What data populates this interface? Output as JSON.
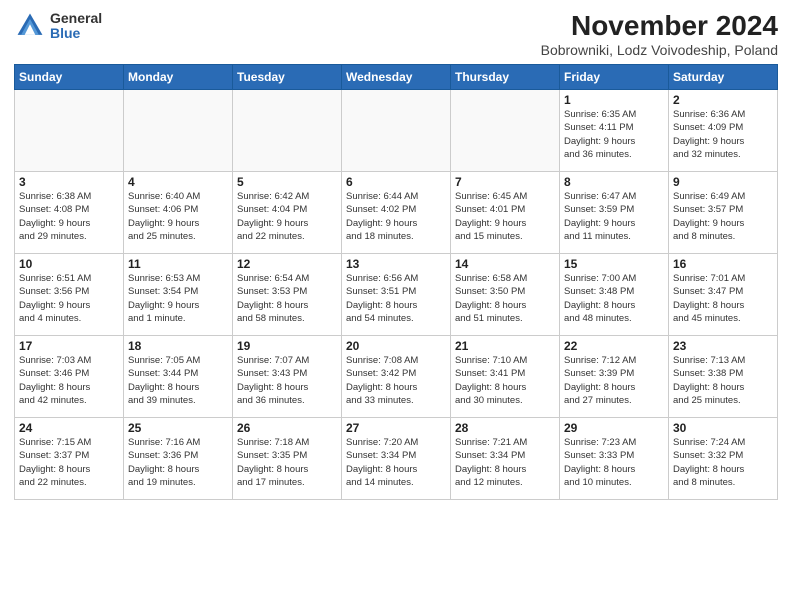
{
  "logo": {
    "general": "General",
    "blue": "Blue"
  },
  "header": {
    "title": "November 2024",
    "subtitle": "Bobrowniki, Lodz Voivodeship, Poland"
  },
  "weekdays": [
    "Sunday",
    "Monday",
    "Tuesday",
    "Wednesday",
    "Thursday",
    "Friday",
    "Saturday"
  ],
  "weeks": [
    [
      {
        "day": "",
        "info": ""
      },
      {
        "day": "",
        "info": ""
      },
      {
        "day": "",
        "info": ""
      },
      {
        "day": "",
        "info": ""
      },
      {
        "day": "",
        "info": ""
      },
      {
        "day": "1",
        "info": "Sunrise: 6:35 AM\nSunset: 4:11 PM\nDaylight: 9 hours\nand 36 minutes."
      },
      {
        "day": "2",
        "info": "Sunrise: 6:36 AM\nSunset: 4:09 PM\nDaylight: 9 hours\nand 32 minutes."
      }
    ],
    [
      {
        "day": "3",
        "info": "Sunrise: 6:38 AM\nSunset: 4:08 PM\nDaylight: 9 hours\nand 29 minutes."
      },
      {
        "day": "4",
        "info": "Sunrise: 6:40 AM\nSunset: 4:06 PM\nDaylight: 9 hours\nand 25 minutes."
      },
      {
        "day": "5",
        "info": "Sunrise: 6:42 AM\nSunset: 4:04 PM\nDaylight: 9 hours\nand 22 minutes."
      },
      {
        "day": "6",
        "info": "Sunrise: 6:44 AM\nSunset: 4:02 PM\nDaylight: 9 hours\nand 18 minutes."
      },
      {
        "day": "7",
        "info": "Sunrise: 6:45 AM\nSunset: 4:01 PM\nDaylight: 9 hours\nand 15 minutes."
      },
      {
        "day": "8",
        "info": "Sunrise: 6:47 AM\nSunset: 3:59 PM\nDaylight: 9 hours\nand 11 minutes."
      },
      {
        "day": "9",
        "info": "Sunrise: 6:49 AM\nSunset: 3:57 PM\nDaylight: 9 hours\nand 8 minutes."
      }
    ],
    [
      {
        "day": "10",
        "info": "Sunrise: 6:51 AM\nSunset: 3:56 PM\nDaylight: 9 hours\nand 4 minutes."
      },
      {
        "day": "11",
        "info": "Sunrise: 6:53 AM\nSunset: 3:54 PM\nDaylight: 9 hours\nand 1 minute."
      },
      {
        "day": "12",
        "info": "Sunrise: 6:54 AM\nSunset: 3:53 PM\nDaylight: 8 hours\nand 58 minutes."
      },
      {
        "day": "13",
        "info": "Sunrise: 6:56 AM\nSunset: 3:51 PM\nDaylight: 8 hours\nand 54 minutes."
      },
      {
        "day": "14",
        "info": "Sunrise: 6:58 AM\nSunset: 3:50 PM\nDaylight: 8 hours\nand 51 minutes."
      },
      {
        "day": "15",
        "info": "Sunrise: 7:00 AM\nSunset: 3:48 PM\nDaylight: 8 hours\nand 48 minutes."
      },
      {
        "day": "16",
        "info": "Sunrise: 7:01 AM\nSunset: 3:47 PM\nDaylight: 8 hours\nand 45 minutes."
      }
    ],
    [
      {
        "day": "17",
        "info": "Sunrise: 7:03 AM\nSunset: 3:46 PM\nDaylight: 8 hours\nand 42 minutes."
      },
      {
        "day": "18",
        "info": "Sunrise: 7:05 AM\nSunset: 3:44 PM\nDaylight: 8 hours\nand 39 minutes."
      },
      {
        "day": "19",
        "info": "Sunrise: 7:07 AM\nSunset: 3:43 PM\nDaylight: 8 hours\nand 36 minutes."
      },
      {
        "day": "20",
        "info": "Sunrise: 7:08 AM\nSunset: 3:42 PM\nDaylight: 8 hours\nand 33 minutes."
      },
      {
        "day": "21",
        "info": "Sunrise: 7:10 AM\nSunset: 3:41 PM\nDaylight: 8 hours\nand 30 minutes."
      },
      {
        "day": "22",
        "info": "Sunrise: 7:12 AM\nSunset: 3:39 PM\nDaylight: 8 hours\nand 27 minutes."
      },
      {
        "day": "23",
        "info": "Sunrise: 7:13 AM\nSunset: 3:38 PM\nDaylight: 8 hours\nand 25 minutes."
      }
    ],
    [
      {
        "day": "24",
        "info": "Sunrise: 7:15 AM\nSunset: 3:37 PM\nDaylight: 8 hours\nand 22 minutes."
      },
      {
        "day": "25",
        "info": "Sunrise: 7:16 AM\nSunset: 3:36 PM\nDaylight: 8 hours\nand 19 minutes."
      },
      {
        "day": "26",
        "info": "Sunrise: 7:18 AM\nSunset: 3:35 PM\nDaylight: 8 hours\nand 17 minutes."
      },
      {
        "day": "27",
        "info": "Sunrise: 7:20 AM\nSunset: 3:34 PM\nDaylight: 8 hours\nand 14 minutes."
      },
      {
        "day": "28",
        "info": "Sunrise: 7:21 AM\nSunset: 3:34 PM\nDaylight: 8 hours\nand 12 minutes."
      },
      {
        "day": "29",
        "info": "Sunrise: 7:23 AM\nSunset: 3:33 PM\nDaylight: 8 hours\nand 10 minutes."
      },
      {
        "day": "30",
        "info": "Sunrise: 7:24 AM\nSunset: 3:32 PM\nDaylight: 8 hours\nand 8 minutes."
      }
    ]
  ]
}
